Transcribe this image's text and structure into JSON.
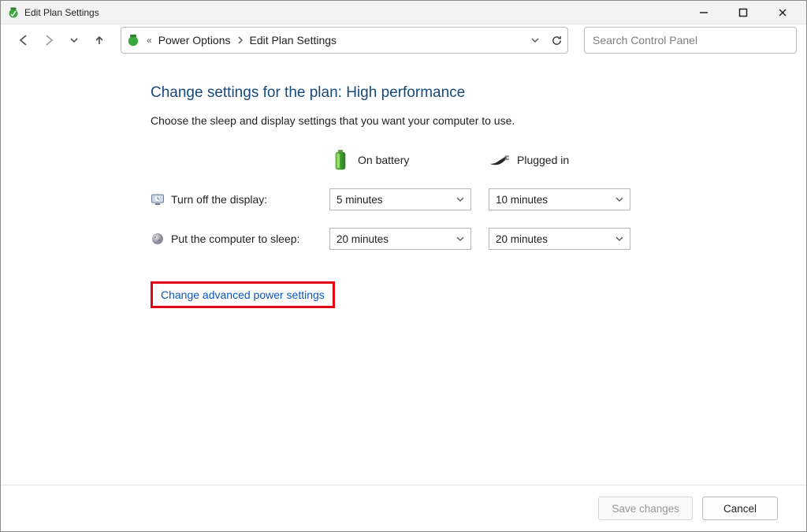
{
  "window": {
    "title": "Edit Plan Settings"
  },
  "breadcrumb": {
    "root": "Power Options",
    "leaf": "Edit Plan Settings"
  },
  "search": {
    "placeholder": "Search Control Panel"
  },
  "heading": "Change settings for the plan: High performance",
  "subtext": "Choose the sleep and display settings that you want your computer to use.",
  "columns": {
    "battery": "On battery",
    "plugged": "Plugged in"
  },
  "rows": {
    "display": {
      "label": "Turn off the display:",
      "battery_value": "5 minutes",
      "plugged_value": "10 minutes"
    },
    "sleep": {
      "label": "Put the computer to sleep:",
      "battery_value": "20 minutes",
      "plugged_value": "20 minutes"
    }
  },
  "link": "Change advanced power settings",
  "buttons": {
    "save": "Save changes",
    "cancel": "Cancel"
  }
}
